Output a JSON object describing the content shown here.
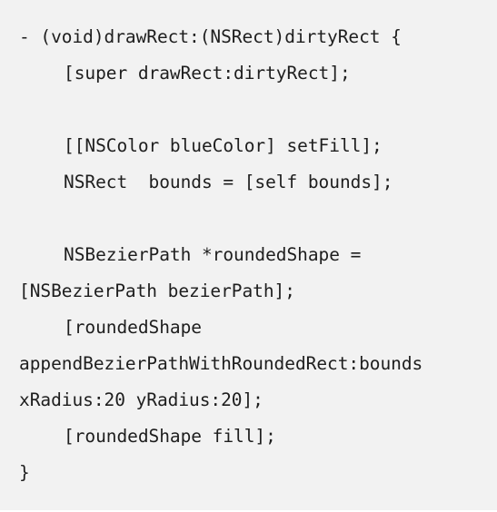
{
  "code": {
    "lines": [
      "- (void)drawRect:(NSRect)dirtyRect {",
      "[super drawRect:dirtyRect];",
      "",
      "[[NSColor blueColor] setFill];",
      "NSRect  bounds = [self bounds];",
      "",
      "NSBezierPath *roundedShape =",
      "[NSBezierPath bezierPath];",
      "[roundedShape",
      "appendBezierPathWithRoundedRect:bounds",
      "xRadius:20 yRadius:20];",
      "[roundedShape fill];",
      "}"
    ]
  }
}
